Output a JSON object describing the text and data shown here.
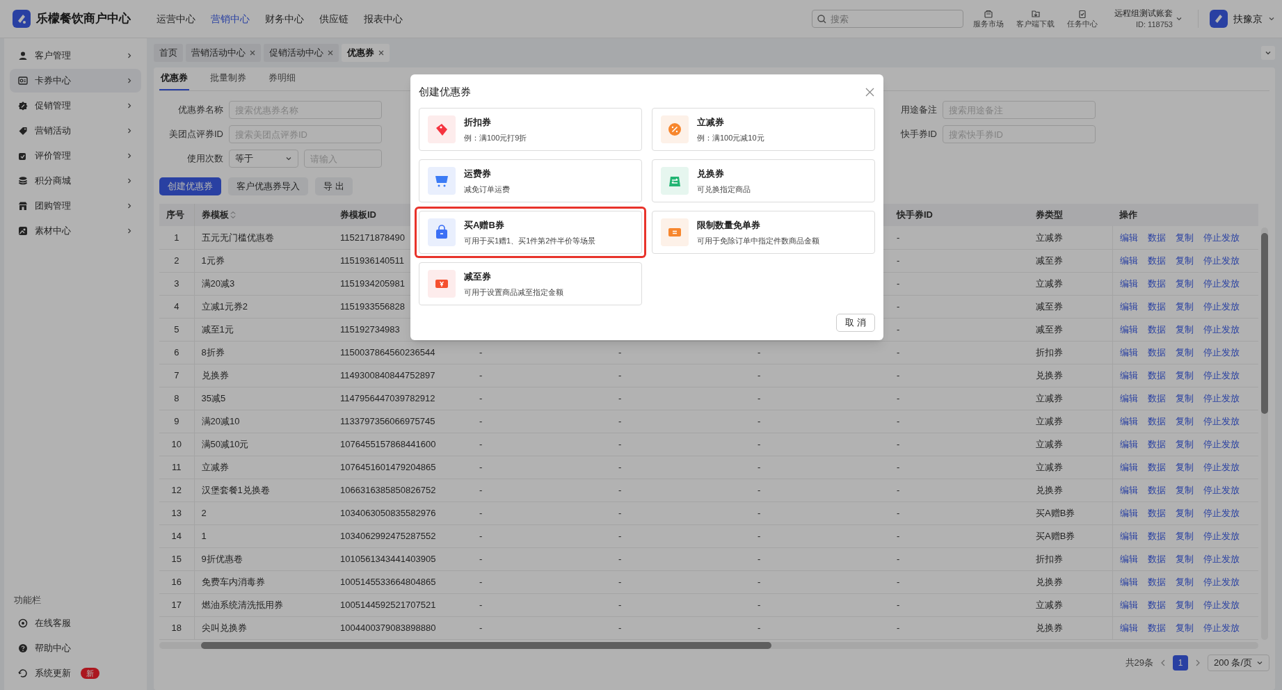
{
  "top_bar": {
    "logo_text": "乐檬餐饮商户中心",
    "nav": [
      {
        "label": "运营中心",
        "selected": false
      },
      {
        "label": "营销中心",
        "selected": true
      },
      {
        "label": "财务中心",
        "selected": false
      },
      {
        "label": "供应链",
        "selected": false
      },
      {
        "label": "报表中心",
        "selected": false
      }
    ],
    "search": {
      "placeholder": "搜索"
    },
    "tools": [
      {
        "label": "服务市场"
      },
      {
        "label": "客户端下载"
      },
      {
        "label": "任务中心"
      }
    ],
    "account": {
      "name": "远程组测试账套",
      "id": "ID: 118753"
    },
    "user": {
      "name": "扶豫京"
    }
  },
  "sidebar": {
    "items": [
      {
        "label": "客户管理",
        "selected": false
      },
      {
        "label": "卡券中心",
        "selected": true
      },
      {
        "label": "促销管理",
        "selected": false
      },
      {
        "label": "营销活动",
        "selected": false
      },
      {
        "label": "评价管理",
        "selected": false
      },
      {
        "label": "积分商城",
        "selected": false
      },
      {
        "label": "团购管理",
        "selected": false
      },
      {
        "label": "素材中心",
        "selected": false
      }
    ],
    "footer_title": "功能栏",
    "footer_items": [
      {
        "label": "在线客服"
      },
      {
        "label": "帮助中心"
      },
      {
        "label": "系统更新",
        "badge": "新"
      }
    ]
  },
  "page_tabs": [
    {
      "label": "首页",
      "closable": false,
      "selected": false
    },
    {
      "label": "营销活动中心",
      "closable": true,
      "selected": false
    },
    {
      "label": "促销活动中心",
      "closable": true,
      "selected": false
    },
    {
      "label": "优惠券",
      "closable": true,
      "selected": true
    }
  ],
  "sub_tabs": [
    {
      "label": "优惠券",
      "selected": true
    },
    {
      "label": "批量制券",
      "selected": false
    },
    {
      "label": "券明细",
      "selected": false
    }
  ],
  "filters_left": [
    {
      "label": "优惠券名称",
      "kind": "text",
      "placeholder": "搜索优惠券名称"
    },
    {
      "label": "美团点评券ID",
      "kind": "text",
      "placeholder": "搜索美团点评券ID"
    },
    {
      "label": "使用次数",
      "kind": "compare",
      "value": "等于",
      "placeholder": "请输入"
    }
  ],
  "filters_right": [
    {
      "label": "用途备注",
      "kind": "text",
      "placeholder": "搜索用途备注"
    },
    {
      "label": "快手券ID",
      "kind": "text",
      "placeholder": "搜索快手券ID"
    }
  ],
  "buttons": [
    {
      "label": "创建优惠券",
      "primary": true
    },
    {
      "label": "客户优惠券导入",
      "primary": false
    },
    {
      "label": "导 出",
      "primary": false
    }
  ],
  "table": {
    "columns": [
      {
        "label": "序号"
      },
      {
        "label": "券模板",
        "sortable": true
      },
      {
        "label": "券模板ID"
      },
      {},
      {},
      {},
      {
        "label": "快手券ID"
      },
      {
        "label": "券类型"
      },
      {
        "label": "操作"
      }
    ],
    "rows": [
      {
        "index": "1",
        "name": "五元无门槛优惠卷",
        "template_id": "1152171878490",
        "kuaishou_id": "-",
        "type": "立减券",
        "actions": [
          "编辑",
          "数据",
          "复制",
          "停止发放"
        ]
      },
      {
        "index": "2",
        "name": "1元券",
        "template_id": "1151936140511",
        "kuaishou_id": "-",
        "type": "减至券",
        "actions": [
          "编辑",
          "数据",
          "复制",
          "停止发放"
        ]
      },
      {
        "index": "3",
        "name": "满20减3",
        "template_id": "1151934205981",
        "kuaishou_id": "-",
        "type": "立减券",
        "actions": [
          "编辑",
          "数据",
          "复制",
          "停止发放"
        ]
      },
      {
        "index": "4",
        "name": "立减1元券2",
        "template_id": "1151933556828",
        "kuaishou_id": "-",
        "type": "减至券",
        "actions": [
          "编辑",
          "数据",
          "复制",
          "停止发放"
        ]
      },
      {
        "index": "5",
        "name": "减至1元",
        "template_id": "115192734983",
        "kuaishou_id": "-",
        "type": "减至券",
        "actions": [
          "编辑",
          "数据",
          "复制",
          "停止发放"
        ]
      },
      {
        "index": "6",
        "name": "8折券",
        "template_id": "1150037864560236544",
        "column_4": "-",
        "column_5": "-",
        "column_6": "-",
        "kuaishou_id": "-",
        "type": "折扣券",
        "actions": [
          "编辑",
          "数据",
          "复制",
          "停止发放"
        ]
      },
      {
        "index": "7",
        "name": "兑换券",
        "template_id": "1149300840844752897",
        "column_4": "-",
        "column_5": "-",
        "column_6": "-",
        "kuaishou_id": "-",
        "type": "兑换券",
        "actions": [
          "编辑",
          "数据",
          "复制",
          "停止发放"
        ]
      },
      {
        "index": "8",
        "name": "35减5",
        "template_id": "1147956447039782912",
        "column_4": "-",
        "column_5": "-",
        "column_6": "-",
        "kuaishou_id": "-",
        "type": "立减券",
        "actions": [
          "编辑",
          "数据",
          "复制",
          "停止发放"
        ]
      },
      {
        "index": "9",
        "name": "满20减10",
        "template_id": "1133797356066975745",
        "column_4": "-",
        "column_5": "-",
        "column_6": "-",
        "kuaishou_id": "-",
        "type": "立减券",
        "actions": [
          "编辑",
          "数据",
          "复制",
          "停止发放"
        ]
      },
      {
        "index": "10",
        "name": "满50减10元",
        "template_id": "1076455157868441600",
        "column_4": "-",
        "column_5": "-",
        "column_6": "-",
        "kuaishou_id": "-",
        "type": "立减券",
        "actions": [
          "编辑",
          "数据",
          "复制",
          "停止发放"
        ]
      },
      {
        "index": "11",
        "name": "立减券",
        "template_id": "1076451601479204865",
        "column_4": "-",
        "column_5": "-",
        "column_6": "-",
        "kuaishou_id": "-",
        "type": "立减券",
        "actions": [
          "编辑",
          "数据",
          "复制",
          "停止发放"
        ]
      },
      {
        "index": "12",
        "name": "汉堡套餐1兑换卷",
        "template_id": "1066316385850826752",
        "column_4": "-",
        "column_5": "-",
        "column_6": "-",
        "kuaishou_id": "-",
        "type": "兑换券",
        "actions": [
          "编辑",
          "数据",
          "复制",
          "停止发放"
        ]
      },
      {
        "index": "13",
        "name": "2",
        "template_id": "1034063050835582976",
        "column_4": "-",
        "column_5": "-",
        "column_6": "-",
        "kuaishou_id": "-",
        "type": "买A赠B券",
        "actions": [
          "编辑",
          "数据",
          "复制",
          "停止发放"
        ]
      },
      {
        "index": "14",
        "name": "1",
        "template_id": "1034062992475287552",
        "column_4": "-",
        "column_5": "-",
        "column_6": "-",
        "kuaishou_id": "-",
        "type": "买A赠B券",
        "actions": [
          "编辑",
          "数据",
          "复制",
          "停止发放"
        ]
      },
      {
        "index": "15",
        "name": "9折优惠卷",
        "template_id": "1010561343441403905",
        "column_4": "-",
        "column_5": "-",
        "column_6": "-",
        "kuaishou_id": "-",
        "type": "折扣券",
        "actions": [
          "编辑",
          "数据",
          "复制",
          "停止发放"
        ]
      },
      {
        "index": "16",
        "name": "免费车内消毒券",
        "template_id": "1005145533664804865",
        "column_4": "-",
        "column_5": "-",
        "column_6": "-",
        "kuaishou_id": "-",
        "type": "兑换券",
        "actions": [
          "编辑",
          "数据",
          "复制",
          "停止发放"
        ]
      },
      {
        "index": "17",
        "name": "燃油系统清洗抵用券",
        "template_id": "1005144592521707521",
        "column_4": "-",
        "column_5": "-",
        "column_6": "-",
        "kuaishou_id": "-",
        "type": "立减券",
        "actions": [
          "编辑",
          "数据",
          "复制",
          "停止发放"
        ]
      },
      {
        "index": "18",
        "name": "尖叫兑换券",
        "template_id": "1004400379083898880",
        "column_4": "-",
        "column_5": "-",
        "column_6": "-",
        "kuaishou_id": "-",
        "type": "兑换券",
        "actions": [
          "编辑",
          "数据",
          "复制",
          "停止发放"
        ]
      }
    ]
  },
  "pagination": {
    "total": "共29条",
    "pages": [
      {
        "label": "1",
        "selected": true
      }
    ],
    "page_size": "200 条/页"
  },
  "modal": {
    "title": "创建优惠券",
    "options": [
      {
        "title": "折扣券",
        "description": "例：满100元打9折",
        "highlighted": false
      },
      {
        "title": "立减券",
        "description": "例：满100元减10元",
        "highlighted": false
      },
      {
        "title": "运费券",
        "description": "减免订单运费",
        "highlighted": false
      },
      {
        "title": "兑换券",
        "description": "可兑换指定商品",
        "highlighted": false
      },
      {
        "title": "买A赠B券",
        "description": "可用于买1赠1、买1件第2件半价等场景",
        "highlighted": true
      },
      {
        "title": "限制数量免单券",
        "description": "可用于免除订单中指定件数商品金额",
        "highlighted": false
      },
      {
        "title": "减至券",
        "description": "可用于设置商品减至指定金额",
        "highlighted": false
      }
    ],
    "cancel": "取 消"
  }
}
